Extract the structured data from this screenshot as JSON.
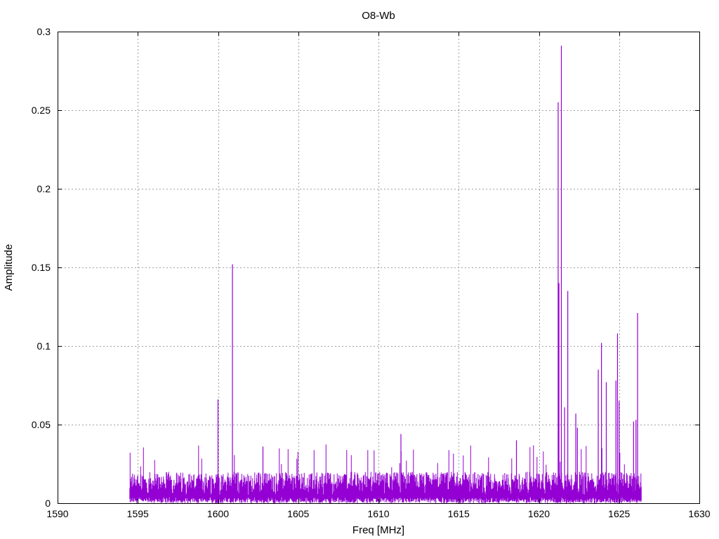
{
  "chart_data": {
    "type": "line",
    "title": "O8-Wb",
    "xlabel": "Freq [MHz]",
    "ylabel": "Amplitude",
    "xlim": [
      1590,
      1630
    ],
    "ylim": [
      0,
      0.3
    ],
    "xticks": [
      1590,
      1595,
      1600,
      1605,
      1610,
      1615,
      1620,
      1625,
      1630
    ],
    "xtick_labels": [
      "1590",
      "1595",
      "1600",
      "1605",
      "1610",
      "1615",
      "1620",
      "1625",
      "1630"
    ],
    "yticks": [
      0,
      0.05,
      0.1,
      0.15,
      0.2,
      0.25,
      0.3
    ],
    "ytick_labels": [
      "0",
      "0.05",
      "0.1",
      "0.15",
      "0.2",
      "0.25",
      "0.3"
    ],
    "grid": true,
    "legend": "none",
    "series": [
      {
        "color": "#9400d3",
        "x_range": [
          1594.5,
          1626.4
        ],
        "noise_floor": [
          0.0,
          0.02
        ],
        "noise_peak_max": 0.038,
        "peaks": [
          {
            "x": 1600.0,
            "y": 0.066
          },
          {
            "x": 1600.9,
            "y": 0.152
          },
          {
            "x": 1602.8,
            "y": 0.036
          },
          {
            "x": 1611.4,
            "y": 0.044
          },
          {
            "x": 1618.6,
            "y": 0.04
          },
          {
            "x": 1621.2,
            "y": 0.255
          },
          {
            "x": 1621.25,
            "y": 0.14
          },
          {
            "x": 1621.4,
            "y": 0.291
          },
          {
            "x": 1621.6,
            "y": 0.061
          },
          {
            "x": 1621.8,
            "y": 0.135
          },
          {
            "x": 1622.3,
            "y": 0.057
          },
          {
            "x": 1622.4,
            "y": 0.048
          },
          {
            "x": 1623.7,
            "y": 0.085
          },
          {
            "x": 1623.9,
            "y": 0.102
          },
          {
            "x": 1624.2,
            "y": 0.077
          },
          {
            "x": 1624.8,
            "y": 0.078
          },
          {
            "x": 1624.9,
            "y": 0.108
          },
          {
            "x": 1625.0,
            "y": 0.065
          },
          {
            "x": 1625.9,
            "y": 0.052
          },
          {
            "x": 1626.05,
            "y": 0.053
          },
          {
            "x": 1626.15,
            "y": 0.121
          }
        ]
      }
    ]
  }
}
